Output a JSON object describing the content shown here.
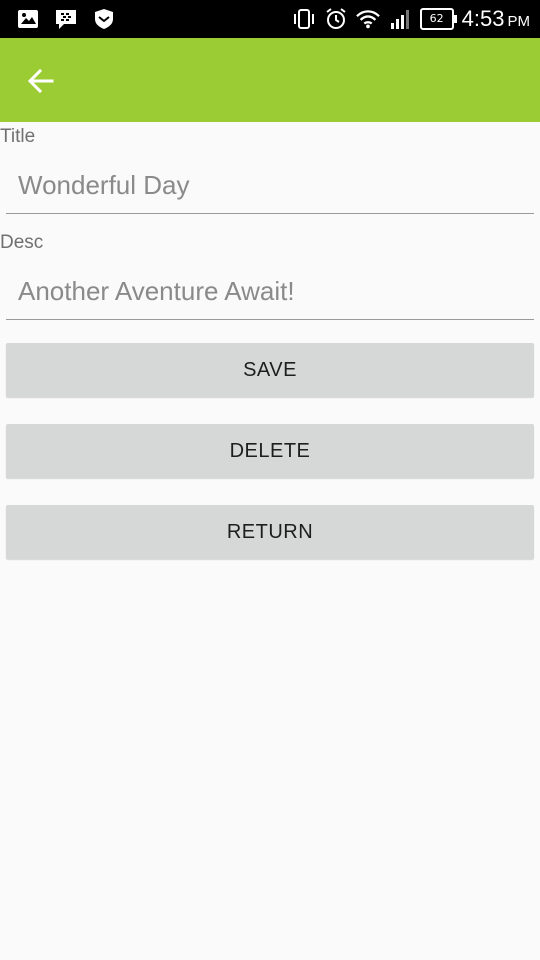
{
  "status_bar": {
    "icons_left": [
      "gallery-icon",
      "bbm-icon",
      "shield-icon"
    ],
    "icons_right": [
      "vibrate-icon",
      "alarm-icon",
      "wifi-icon",
      "signal-icon"
    ],
    "battery_level": "62",
    "time": "4:53",
    "ampm": "PM"
  },
  "app_bar": {
    "color": "#9ccc34",
    "back_icon": "arrow-back-icon"
  },
  "form": {
    "title_label": "Title",
    "title_value": "Wonderful Day",
    "desc_label": "Desc",
    "desc_value": "Another Aventure Await!"
  },
  "buttons": {
    "save": "SAVE",
    "delete": "DELETE",
    "return": "RETURN"
  }
}
